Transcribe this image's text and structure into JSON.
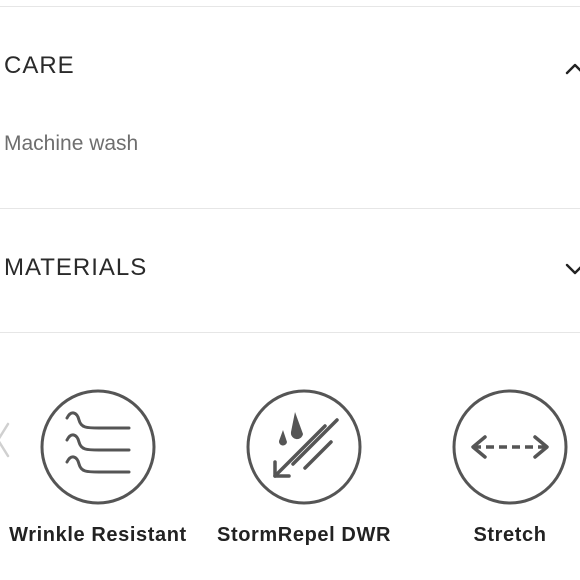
{
  "care": {
    "title": "CARE",
    "body": "Machine wash",
    "chevron_icon": "chevron-up-icon",
    "expanded": true
  },
  "materials": {
    "title": "MATERIALS",
    "chevron_icon": "chevron-down-icon",
    "expanded": false
  },
  "features": {
    "prev_icon": "chevron-left-icon",
    "items": [
      {
        "label": "Wrinkle Resistant",
        "icon": "wrinkle-resistant-icon"
      },
      {
        "label": "StormRepel DWR",
        "icon": "storm-repel-icon"
      },
      {
        "label": "Stretch",
        "icon": "stretch-icon"
      }
    ]
  },
  "colors": {
    "text": "#222222",
    "muted": "#6e6e6e",
    "divider": "#e6e6e6",
    "icon_stroke": "#555555"
  }
}
